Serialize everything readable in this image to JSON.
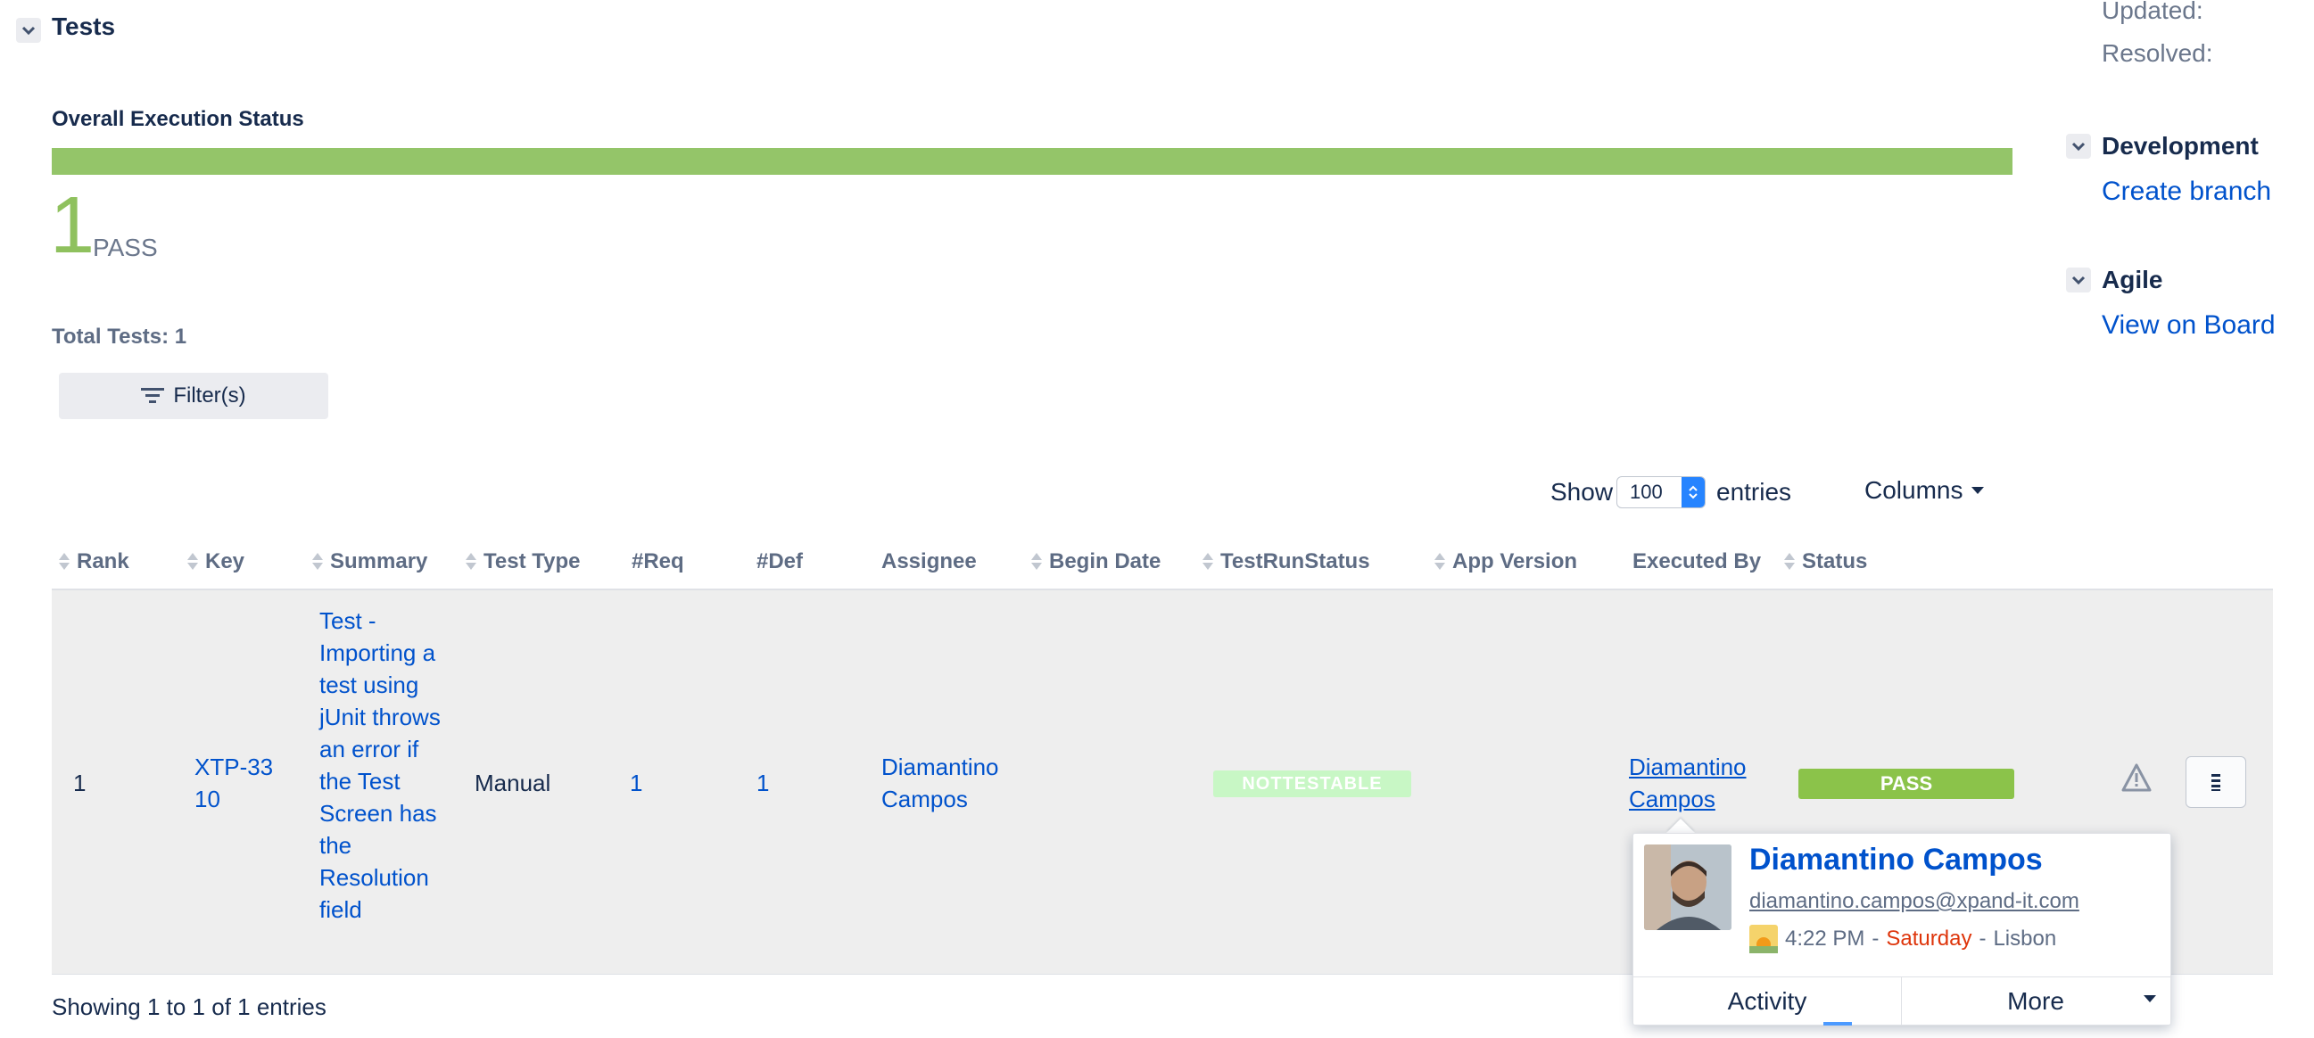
{
  "tests_section": {
    "title": "Tests",
    "overall_label": "Overall Execution Status",
    "progress_fraction": 1.0,
    "pass_count": "1",
    "pass_word": "PASS",
    "total_tests": "Total Tests: 1",
    "filter_button": "Filter(s)"
  },
  "entries_control": {
    "show_label": "Show",
    "value": "100",
    "entries_label": "entries",
    "columns_button": "Columns"
  },
  "table": {
    "headers": [
      "Rank",
      "Key",
      "Summary",
      "Test Type",
      "#Req",
      "#Def",
      "Assignee",
      "Begin Date",
      "TestRunStatus",
      "App Version",
      "Executed By",
      "Status"
    ],
    "row": {
      "rank": "1",
      "key": "XTP-3310",
      "summary": "Test - Importing a test using jUnit throws an error if the Test Screen has the Resolution field",
      "test_type": "Manual",
      "req": "1",
      "def": "1",
      "assignee": "Diamantino Campos",
      "begin_date": "",
      "test_run_status": "NOTTESTABLE",
      "app_version": "",
      "executed_by": "Diamantino Campos",
      "status": "PASS"
    },
    "footer": "Showing 1 to 1 of 1 entries"
  },
  "sidebar": {
    "updated_label": "Updated:",
    "resolved_label": "Resolved:",
    "development_title": "Development",
    "create_branch": "Create branch",
    "agile_title": "Agile",
    "view_on_board": "View on Board"
  },
  "user_popover": {
    "name": "Diamantino Campos",
    "email": "diamantino.campos@xpand-it.com",
    "time": "4:22 PM",
    "sep1": "-",
    "day": "Saturday",
    "sep2": "-",
    "location": "Lisbon",
    "activity_button": "Activity",
    "more_button": "More"
  },
  "colors": {
    "pass_green": "#8bc34a",
    "progress_green": "#94c569",
    "link_blue": "#0052cc",
    "nottestable_bg": "#c8f7c5",
    "day_red": "#de350b"
  }
}
